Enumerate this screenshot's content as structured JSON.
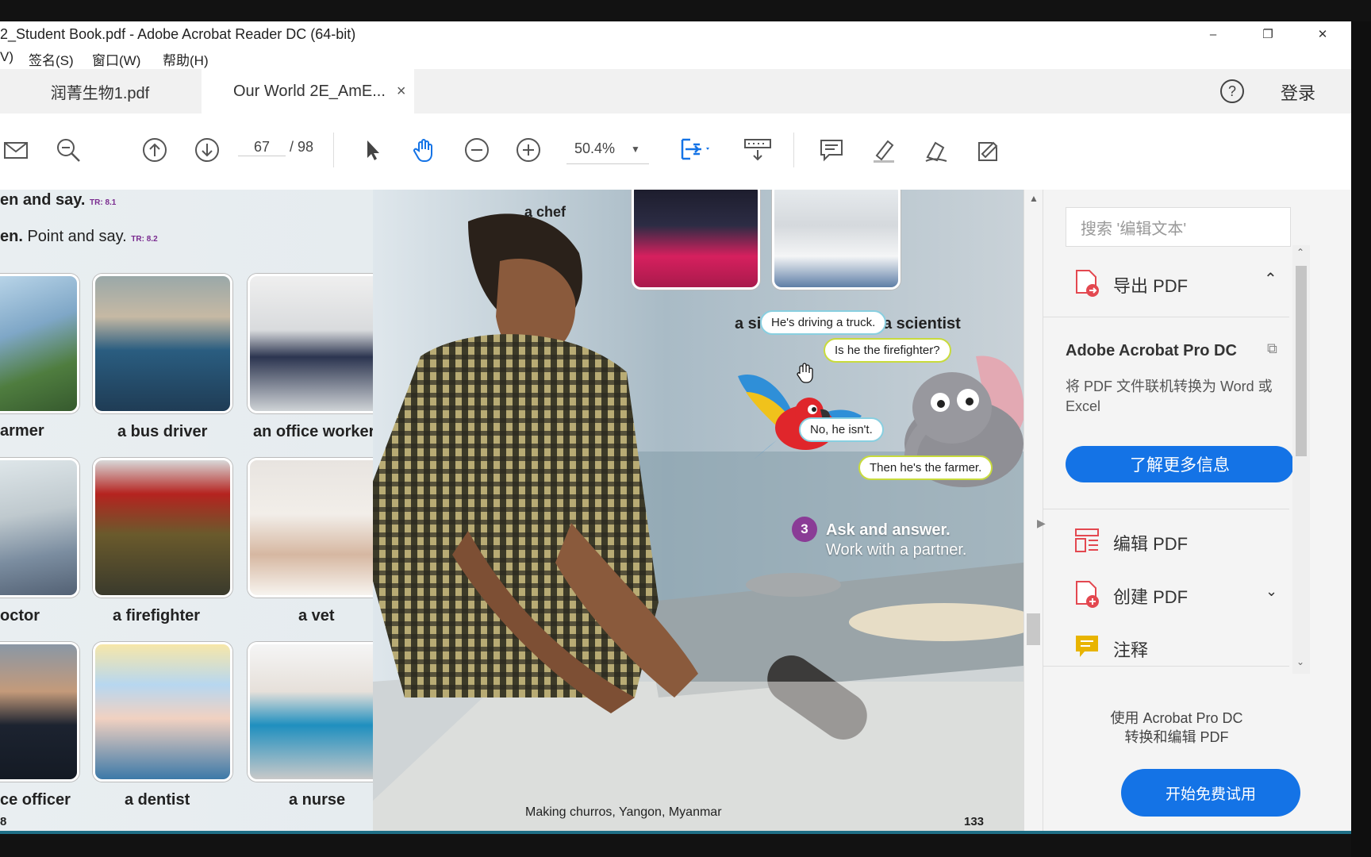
{
  "window": {
    "title": "2_Student Book.pdf - Adobe Acrobat Reader DC (64-bit)",
    "controls": {
      "minimize": "–",
      "restore": "❐",
      "close": "✕"
    }
  },
  "menu": [
    "V)",
    "签名(S)",
    "窗口(W)",
    "帮助(H)"
  ],
  "tabs": [
    {
      "label": "润菁生物1.pdf",
      "active": false
    },
    {
      "label": "Our World 2E_AmE...",
      "active": true,
      "close": "×"
    }
  ],
  "header_right": {
    "help": "?",
    "login": "登录"
  },
  "toolbar": {
    "page_current": "67",
    "page_total": "/ 98",
    "zoom": "50.4%"
  },
  "document": {
    "heading1": "en and say.",
    "heading1_tr": "TR: 8.1",
    "heading2_bold": "en.",
    "heading2_rest": " Point and say.",
    "heading2_tr": "TR: 8.2",
    "captions": {
      "farmer": "armer",
      "bus_driver": "a bus driver",
      "office_worker": "an office worker",
      "doctor": "octor",
      "firefighter": "a firefighter",
      "vet": "a vet",
      "police_officer": "ce officer",
      "dentist": "a dentist",
      "nurse": "a nurse",
      "chef": "a chef",
      "singer": "a singer",
      "scientist": "a scientist"
    },
    "bubbles": {
      "b1": "He's driving a truck.",
      "b2": "Is he the firefighter?",
      "b3": "No, he isn't.",
      "b4": "Then he's the farmer."
    },
    "activity_number": "3",
    "activity_title": "Ask and answer.",
    "activity_sub": "Work with a partner.",
    "photo_caption": "Making churros, Yangon, Myanmar",
    "page_left": "8",
    "page_right": "133"
  },
  "panel": {
    "search_placeholder": "搜索 '编辑文本'",
    "export_pdf": "导出 PDF",
    "product": "Adobe Acrobat Pro DC",
    "product_desc": "将 PDF 文件联机转换为 Word 或 Excel",
    "learn_more": "了解更多信息",
    "edit_pdf": "编辑 PDF",
    "create_pdf": "创建 PDF",
    "comment": "注释",
    "promo_line1": "使用 Acrobat Pro DC",
    "promo_line2": "转换和编辑 PDF",
    "trial": "开始免费试用"
  },
  "colors": {
    "accent_blue": "#1473e6",
    "red_icon": "#e34850",
    "yellow_icon": "#e8b400",
    "active_tool": "#1473e6"
  }
}
